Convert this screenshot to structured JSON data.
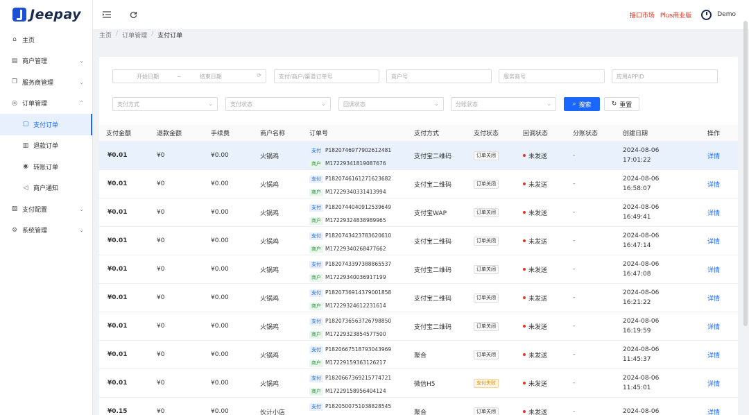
{
  "app": {
    "name": "Jeepay"
  },
  "header": {
    "links": [
      "接口市场",
      "Plus商业版"
    ],
    "user": "Demo"
  },
  "sidebar": {
    "items": [
      {
        "label": "主页",
        "icon": "home-icon",
        "sub": false,
        "arrow": ""
      },
      {
        "label": "商户管理",
        "icon": "store-icon",
        "sub": false,
        "arrow": "⌄"
      },
      {
        "label": "服务商管理",
        "icon": "copy-icon",
        "sub": false,
        "arrow": "⌄"
      },
      {
        "label": "订单管理",
        "icon": "target-icon",
        "sub": false,
        "arrow": "⌃"
      },
      {
        "label": "支付订单",
        "icon": "doc-icon",
        "sub": true,
        "arrow": "",
        "active": true
      },
      {
        "label": "退款订单",
        "icon": "refund-icon",
        "sub": true,
        "arrow": ""
      },
      {
        "label": "转账订单",
        "icon": "transfer-icon",
        "sub": true,
        "arrow": ""
      },
      {
        "label": "商户通知",
        "icon": "notify-icon",
        "sub": true,
        "arrow": ""
      },
      {
        "label": "支付配置",
        "icon": "config-icon",
        "sub": false,
        "arrow": "⌄"
      },
      {
        "label": "系统管理",
        "icon": "gear-icon",
        "sub": false,
        "arrow": "⌄"
      }
    ]
  },
  "breadcrumb": [
    "主页",
    "订单管理",
    "支付订单"
  ],
  "filters": {
    "start_date": "开始日期",
    "date_sep": "~",
    "end_date": "结束日期",
    "order_no": "支付/商户/渠道订单号",
    "mch_no": "商户号",
    "isv_no": "服务商号",
    "app_id": "应用APPID",
    "way_code": "支付方式",
    "state": "支付状态",
    "notify_state": "回调状态",
    "division_state": "分账状态",
    "search_label": "搜索",
    "reset_label": "重置"
  },
  "table": {
    "headers": [
      "支付金额",
      "退款金额",
      "手续费",
      "商户名称",
      "订单号",
      "支付方式",
      "支付状态",
      "回调状态",
      "分账状态",
      "创建日期",
      "操作"
    ],
    "pay_tag": "支付",
    "mch_tag": "商户",
    "op_label": "详情",
    "rows": [
      {
        "amount": "¥0.01",
        "refund": "¥0",
        "fee": "¥0.00",
        "mch_name": "火锅鸡",
        "pay_order": "P1820746977902612481",
        "mch_order": "M17229341819087676",
        "way": "支付宝二维码",
        "state": "订单关闭",
        "state_fail": false,
        "notify": "未发送",
        "division": "-",
        "date": "2024-08-06",
        "time": "17:01:22"
      },
      {
        "amount": "¥0.01",
        "refund": "¥0",
        "fee": "¥0.00",
        "mch_name": "火锅鸡",
        "pay_order": "P1820746161271623682",
        "mch_order": "M17229340331413994",
        "way": "支付宝二维码",
        "state": "订单关闭",
        "state_fail": false,
        "notify": "未发送",
        "division": "-",
        "date": "2024-08-06",
        "time": "16:58:07"
      },
      {
        "amount": "¥0.01",
        "refund": "¥0",
        "fee": "¥0.00",
        "mch_name": "火锅鸡",
        "pay_order": "P1820744040912539649",
        "mch_order": "M17229324838989965",
        "way": "支付宝WAP",
        "state": "订单关闭",
        "state_fail": false,
        "notify": "未发送",
        "division": "-",
        "date": "2024-08-06",
        "time": "16:49:41"
      },
      {
        "amount": "¥0.01",
        "refund": "¥0",
        "fee": "¥0.00",
        "mch_name": "火锅鸡",
        "pay_order": "P1820743423783620610",
        "mch_order": "M17229340268477662",
        "way": "支付宝二维码",
        "state": "订单关闭",
        "state_fail": false,
        "notify": "未发送",
        "division": "-",
        "date": "2024-08-06",
        "time": "16:47:14"
      },
      {
        "amount": "¥0.01",
        "refund": "¥0",
        "fee": "¥0.00",
        "mch_name": "火锅鸡",
        "pay_order": "P1820743397388865537",
        "mch_order": "M17229340036917199",
        "way": "支付宝二维码",
        "state": "订单关闭",
        "state_fail": false,
        "notify": "未发送",
        "division": "-",
        "date": "2024-08-06",
        "time": "16:47:08"
      },
      {
        "amount": "¥0.01",
        "refund": "¥0",
        "fee": "¥0.00",
        "mch_name": "火锅鸡",
        "pay_order": "P1820736914379001858",
        "mch_order": "M17229324612231614",
        "way": "支付宝二维码",
        "state": "订单关闭",
        "state_fail": false,
        "notify": "未发送",
        "division": "-",
        "date": "2024-08-06",
        "time": "16:21:22"
      },
      {
        "amount": "¥0.01",
        "refund": "¥0",
        "fee": "¥0.00",
        "mch_name": "火锅鸡",
        "pay_order": "P1820736563726798850",
        "mch_order": "M17229323854577500",
        "way": "支付宝二维码",
        "state": "订单关闭",
        "state_fail": false,
        "notify": "未发送",
        "division": "-",
        "date": "2024-08-06",
        "time": "16:19:59"
      },
      {
        "amount": "¥0.01",
        "refund": "¥0",
        "fee": "¥0.00",
        "mch_name": "火锅鸡",
        "pay_order": "P1820667518793043969",
        "mch_order": "M17229159363126217",
        "way": "聚合",
        "state": "订单关闭",
        "state_fail": false,
        "notify": "未发送",
        "division": "-",
        "date": "2024-08-06",
        "time": "11:45:37"
      },
      {
        "amount": "¥0.01",
        "refund": "¥0",
        "fee": "¥0.00",
        "mch_name": "火锅鸡",
        "pay_order": "P1820667369215774721",
        "mch_order": "M17229158956404124",
        "way": "微信H5",
        "state": "支付失败",
        "state_fail": true,
        "notify": "未发送",
        "division": "-",
        "date": "2024-08-06",
        "time": "11:45:01"
      },
      {
        "amount": "¥0.15",
        "refund": "¥0",
        "fee": "¥0.00",
        "mch_name": "伙计小店",
        "pay_order": "P1820500751038828545",
        "mch_order": "",
        "way": "聚合",
        "state": "订单关闭",
        "state_fail": false,
        "notify": "未发送",
        "division": "-",
        "date": "2024-08-06",
        "time": ""
      }
    ]
  }
}
